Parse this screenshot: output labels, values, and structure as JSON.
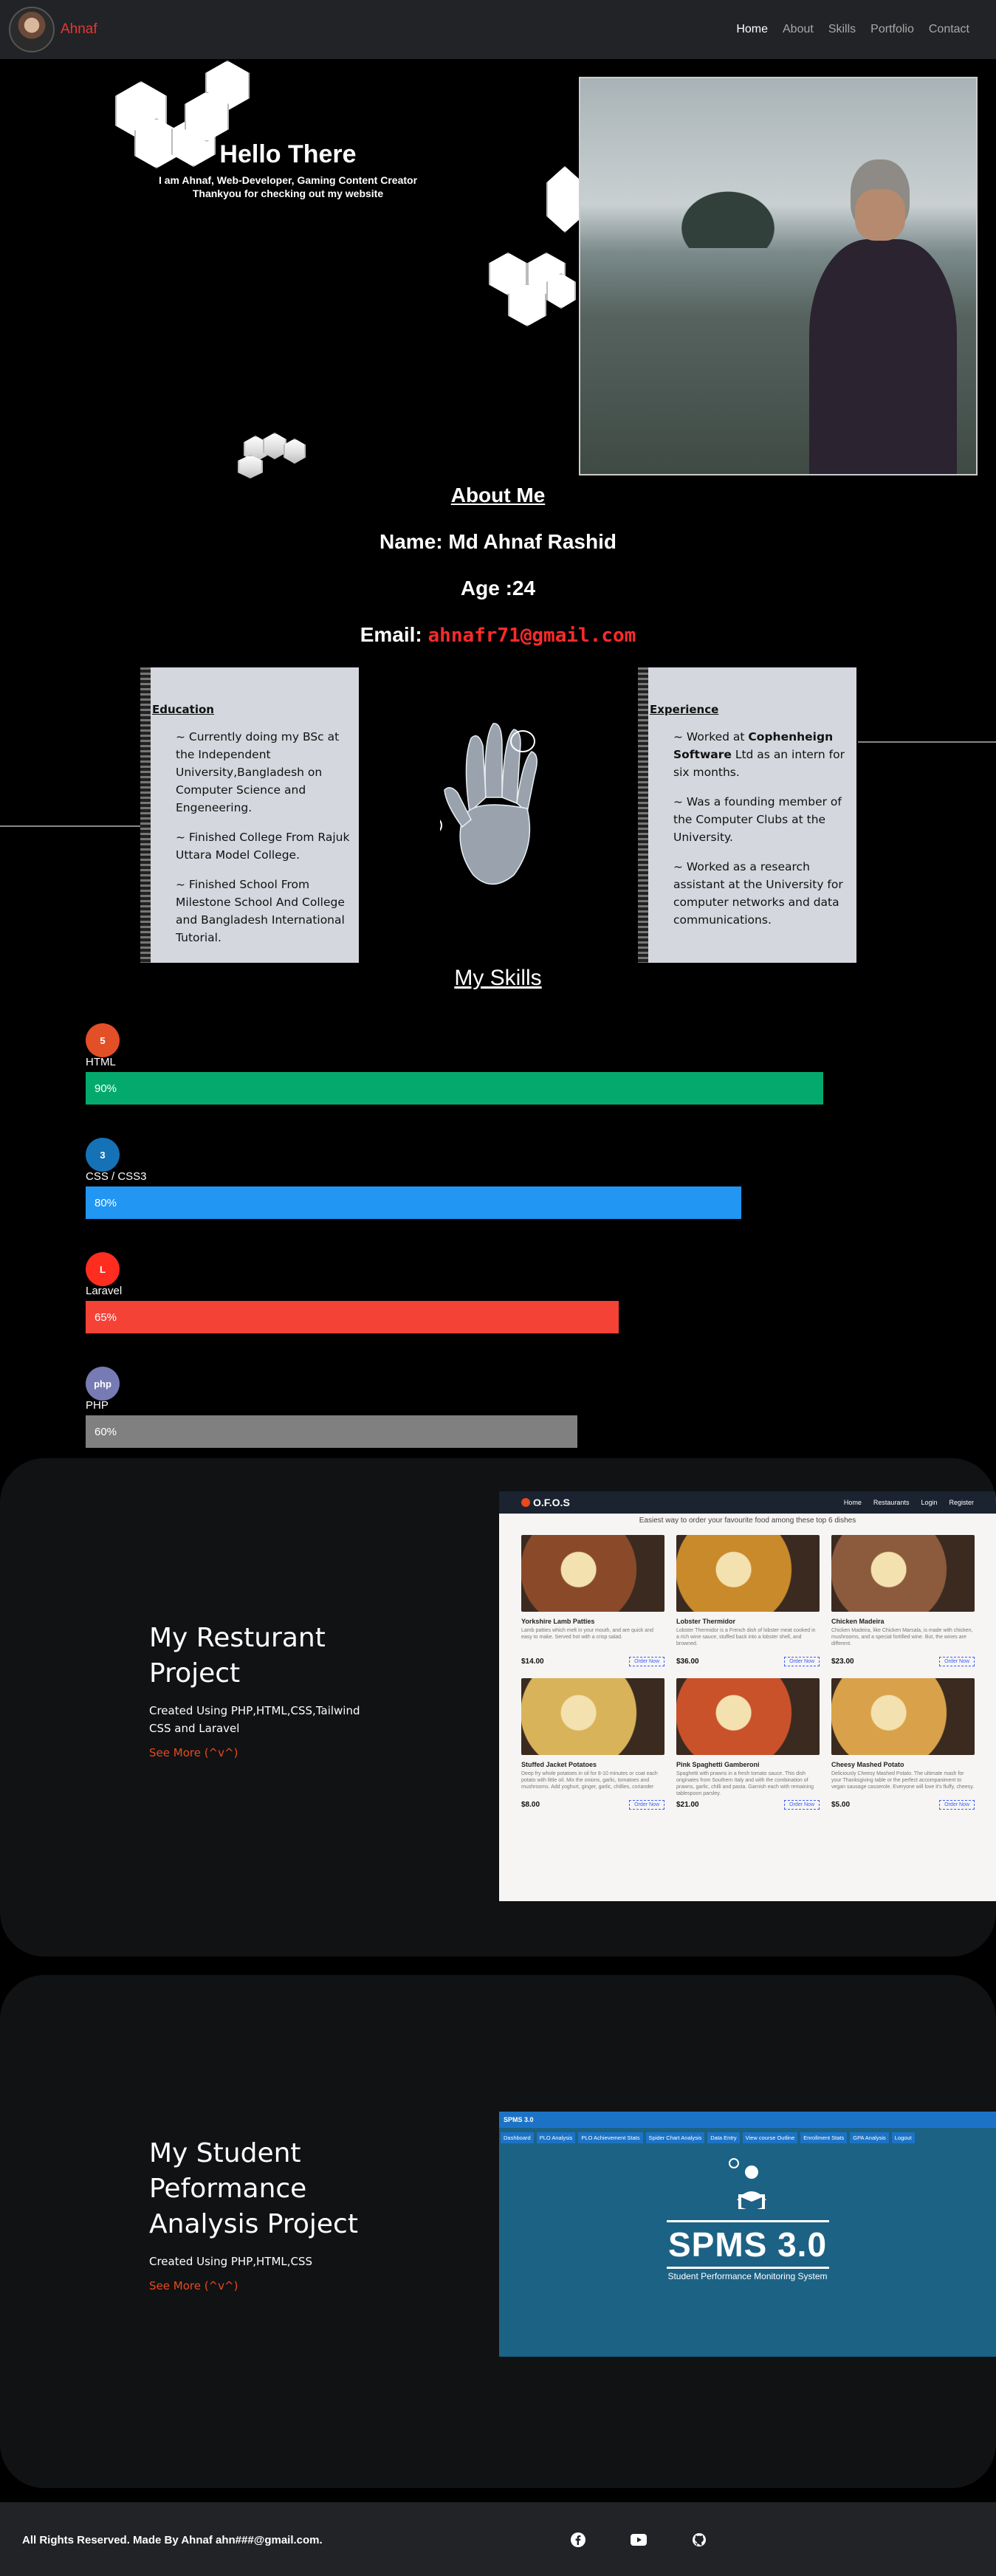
{
  "navbar": {
    "brand": "Ahnaf",
    "links": [
      "Home",
      "About",
      "Skills",
      "Portfolio",
      "Contact"
    ],
    "active": "Home"
  },
  "hero": {
    "title": "Hello There",
    "subtitle_line1": "I am Ahnaf, Web-Developer, Gaming Content Creator",
    "subtitle_line2": "Thankyou for checking out my website"
  },
  "about": {
    "heading": "About Me",
    "name": "Name: Md Ahnaf Rashid",
    "age": "Age :24",
    "email_label": "Email: ",
    "email_value": "ahnafr71@gmail.com",
    "education": {
      "heading": "Education",
      "items": [
        "~ Currently doing my BSc at the Independent University,Bangladesh on Computer Science and Engeneering.",
        "~ Finished College From Rajuk Uttara Model College.",
        "~ Finished School From Milestone School And College and Bangladesh International Tutorial."
      ]
    },
    "experience": {
      "heading": "Experience",
      "item1_prefix": "~ Worked at ",
      "item1_bold": "Cophenheign Software",
      "item1_suffix": " Ltd as an intern for six months.",
      "items": [
        "~ Was a founding member of the Computer Clubs at the University.",
        "~ Worked as a research assistant at the University for computer networks and data communications."
      ]
    }
  },
  "skills": {
    "heading": "My Skills",
    "items": [
      {
        "name": "HTML",
        "label": "90%",
        "level": 90,
        "color": "#04aa6d",
        "icon": "html5-icon",
        "icon_color": "#e34f26",
        "icon_text": "5"
      },
      {
        "name": "CSS / CSS3",
        "label": "80%",
        "level": 80,
        "color": "#2196f3",
        "icon": "css3-icon",
        "icon_color": "#1572b6",
        "icon_text": "3"
      },
      {
        "name": "Laravel",
        "label": "65%",
        "level": 65,
        "color": "#f44336",
        "icon": "laravel-icon",
        "icon_color": "#ff2d20",
        "icon_text": "L"
      },
      {
        "name": "PHP",
        "label": "60%",
        "level": 60,
        "color": "#808080",
        "icon": "php-icon",
        "icon_color": "#777bb3",
        "icon_text": "php"
      }
    ]
  },
  "projects": [
    {
      "title": "My Resturant Project",
      "desc": "Created Using PHP,HTML,CSS,Tailwind CSS and Laravel",
      "link": "See More (^v^)",
      "screenshot": {
        "logo": "O.F.O.S",
        "links": [
          "Home",
          "Restaurants",
          "Login",
          "Register"
        ],
        "headline": "Easiest way to order your favourite food among these top 6 dishes",
        "button": "Order Now",
        "dishes": [
          {
            "name": "Yorkshire Lamb Patties",
            "desc": "Lamb patties which melt in your mouth, and are quick and easy to make. Served hot with a crisp salad.",
            "price": "$14.00",
            "color": "#8a4a2a"
          },
          {
            "name": "Lobster Thermidor",
            "desc": "Lobster Thermidor is a French dish of lobster meat cooked in a rich wine sauce, stuffed back into a lobster shell, and browned.",
            "price": "$36.00",
            "color": "#c98a2b"
          },
          {
            "name": "Chicken Madeira",
            "desc": "Chicken Madeira, like Chicken Marsala, is made with chicken, mushrooms, and a special fortified wine. But, the wines are different.",
            "price": "$23.00",
            "color": "#8c5a3c"
          },
          {
            "name": "Stuffed Jacket Potatoes",
            "desc": "Deep fry whole potatoes in oil for 8-10 minutes or coat each potato with little oil. Mix the onions, garlic, tomatoes and mushrooms. Add yoghurt, ginger, garlic, chillies, coriander",
            "price": "$8.00",
            "color": "#d9b35a"
          },
          {
            "name": "Pink Spaghetti Gamberoni",
            "desc": "Spaghetti with prawns in a fresh tomato sauce. This dish originates from Southern Italy and with the combination of prawns, garlic, chilli and pasta. Garnish each with remaining tablespoon parsley.",
            "price": "$21.00",
            "color": "#c9522a"
          },
          {
            "name": "Cheesy Mashed Potato",
            "desc": "Deliciously Cheesy Mashed Potato. The ultimate mash for your Thanksgiving table or the perfect accompaniment to vegan sausage casserole. Everyone will love it's fluffy, cheesy.",
            "price": "$5.00",
            "color": "#d9a24a"
          }
        ]
      }
    },
    {
      "title": "My Student Peformance Analysis Project",
      "desc": "Created Using PHP,HTML,CSS",
      "link": "See More (^v^)",
      "screenshot": {
        "header": "SPMS 3.0",
        "tabs": [
          "Dashboard",
          "PLO Analysis",
          "PLO Achievement Stats",
          "Spider Chart Analysis",
          "Data Entry",
          "View course Outline",
          "Enrollment Stats",
          "GPA Analysis",
          "Logout"
        ],
        "logo": "SPMS 3.0",
        "logo_sub": "Student Performance Monitoring System"
      }
    }
  ],
  "footer": {
    "text": "All Rights Reserved. Made By Ahnaf ahn###@gmail.com."
  }
}
